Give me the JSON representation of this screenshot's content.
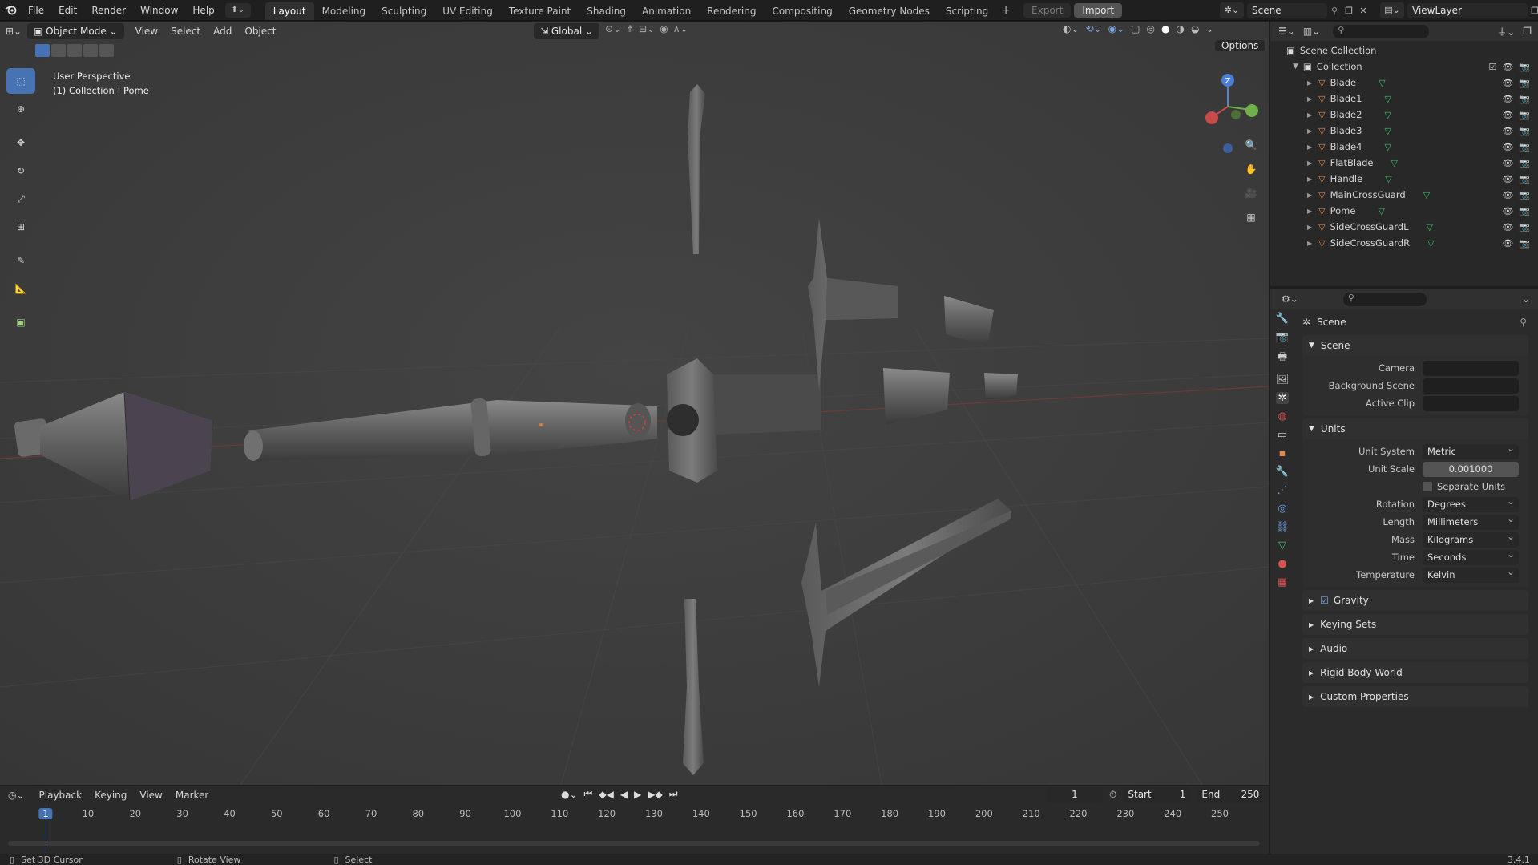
{
  "top_menu": {
    "menu": [
      "File",
      "Edit",
      "Render",
      "Window",
      "Help"
    ]
  },
  "workspaces": {
    "tabs": [
      "Layout",
      "Modeling",
      "Sculpting",
      "UV Editing",
      "Texture Paint",
      "Shading",
      "Animation",
      "Rendering",
      "Compositing",
      "Geometry Nodes",
      "Scripting"
    ],
    "active": "Layout"
  },
  "top_buttons": {
    "export": "Export",
    "import": "Import"
  },
  "scene_field": "Scene",
  "viewlayer_field": "ViewLayer",
  "viewport": {
    "mode": "Object Mode",
    "menu": [
      "View",
      "Select",
      "Add",
      "Object"
    ],
    "orientation": "Global",
    "options": "Options",
    "overlay_title": "User Perspective",
    "overlay_subtitle": "(1) Collection | Pome",
    "gizmo_z": "Z"
  },
  "outliner": {
    "root": "Scene Collection",
    "collection": "Collection",
    "objects": [
      "Blade",
      "Blade1",
      "Blade2",
      "Blade3",
      "Blade4",
      "FlatBlade",
      "Handle",
      "MainCrossGuard",
      "Pome",
      "SideCrossGuardL",
      "SideCrossGuardR"
    ]
  },
  "properties": {
    "context": "Scene",
    "scene_panel": {
      "title": "Scene",
      "rows": [
        {
          "label": "Camera",
          "value": ""
        },
        {
          "label": "Background Scene",
          "value": ""
        },
        {
          "label": "Active Clip",
          "value": ""
        }
      ]
    },
    "units_panel": {
      "title": "Units",
      "unit_system_label": "Unit System",
      "unit_system": "Metric",
      "unit_scale_label": "Unit Scale",
      "unit_scale": "0.001000",
      "separate_units": "Separate Units",
      "rows": [
        {
          "label": "Rotation",
          "value": "Degrees"
        },
        {
          "label": "Length",
          "value": "Millimeters"
        },
        {
          "label": "Mass",
          "value": "Kilograms"
        },
        {
          "label": "Time",
          "value": "Seconds"
        },
        {
          "label": "Temperature",
          "value": "Kelvin"
        }
      ]
    },
    "collapsed": [
      "Gravity",
      "Keying Sets",
      "Audio",
      "Rigid Body World",
      "Custom Properties"
    ]
  },
  "timeline": {
    "menu": [
      "Playback",
      "Keying",
      "View",
      "Marker"
    ],
    "current_frame": "1",
    "start_label": "Start",
    "start": "1",
    "end_label": "End",
    "end": "250",
    "ticks": [
      "1",
      "10",
      "20",
      "30",
      "40",
      "50",
      "60",
      "70",
      "80",
      "90",
      "100",
      "110",
      "120",
      "130",
      "140",
      "150",
      "160",
      "170",
      "180",
      "190",
      "200",
      "210",
      "220",
      "230",
      "240",
      "250"
    ]
  },
  "status": {
    "left": "Set 3D Cursor",
    "mid": "Rotate View",
    "right": "Select",
    "version": "3.4.1"
  },
  "colors": {
    "accent": "#4772b3",
    "selection": "#334d80",
    "mesh_icon": "#3ebf6b",
    "object_icon": "#e0894b"
  }
}
